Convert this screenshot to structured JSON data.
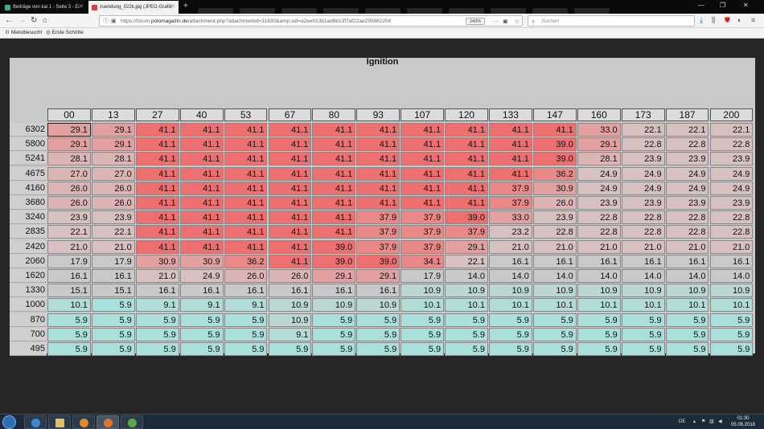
{
  "browser": {
    "tabs": [
      {
        "label": "Beiträge von kai 1 - Seite 3 - Ei"
      },
      {
        "label": "zuendung_022k.jpg (JPEG-Grafik"
      }
    ],
    "url_prefix": "https://forum.",
    "url_domain": "polomagazin.de",
    "url_path": "/attachment.php?attachmentid=31630&amp;sid=a2ee013b1ad6b13f7af22ae290862204",
    "zoom": "240%",
    "search_placeholder": "Suchen",
    "bookmarks": [
      "Meistbesucht",
      "Erste Schritte"
    ]
  },
  "table": {
    "title": "Ignition",
    "columns": [
      "00",
      "13",
      "27",
      "40",
      "53",
      "67",
      "80",
      "93",
      "107",
      "120",
      "133",
      "147",
      "160",
      "173",
      "187",
      "200"
    ],
    "rows": [
      {
        "rpm": "6302",
        "values": [
          "29.1",
          "29.1",
          "41.1",
          "41.1",
          "41.1",
          "41.1",
          "41.1",
          "41.1",
          "41.1",
          "41.1",
          "41.1",
          "41.1",
          "33.0",
          "22.1",
          "22.1",
          "22.1"
        ]
      },
      {
        "rpm": "5800",
        "values": [
          "29.1",
          "29.1",
          "41.1",
          "41.1",
          "41.1",
          "41.1",
          "41.1",
          "41.1",
          "41.1",
          "41.1",
          "41.1",
          "39.0",
          "29.1",
          "22.8",
          "22.8",
          "22.8"
        ]
      },
      {
        "rpm": "5241",
        "values": [
          "28.1",
          "28.1",
          "41.1",
          "41.1",
          "41.1",
          "41.1",
          "41.1",
          "41.1",
          "41.1",
          "41.1",
          "41.1",
          "39.0",
          "28.1",
          "23.9",
          "23.9",
          "23.9"
        ]
      },
      {
        "rpm": "4675",
        "values": [
          "27.0",
          "27.0",
          "41.1",
          "41.1",
          "41.1",
          "41.1",
          "41.1",
          "41.1",
          "41.1",
          "41.1",
          "41.1",
          "36.2",
          "24.9",
          "24.9",
          "24.9",
          "24.9"
        ]
      },
      {
        "rpm": "4160",
        "values": [
          "26.0",
          "26.0",
          "41.1",
          "41.1",
          "41.1",
          "41.1",
          "41.1",
          "41.1",
          "41.1",
          "41.1",
          "37.9",
          "30.9",
          "24.9",
          "24.9",
          "24.9",
          "24.9"
        ]
      },
      {
        "rpm": "3680",
        "values": [
          "26.0",
          "26.0",
          "41.1",
          "41.1",
          "41.1",
          "41.1",
          "41.1",
          "41.1",
          "41.1",
          "41.1",
          "37.9",
          "26.0",
          "23.9",
          "23.9",
          "23.9",
          "23.9"
        ]
      },
      {
        "rpm": "3240",
        "values": [
          "23.9",
          "23.9",
          "41.1",
          "41.1",
          "41.1",
          "41.1",
          "41.1",
          "37.9",
          "37.9",
          "39.0",
          "33.0",
          "23.9",
          "22.8",
          "22.8",
          "22.8",
          "22.8"
        ]
      },
      {
        "rpm": "2835",
        "values": [
          "22.1",
          "22.1",
          "41.1",
          "41.1",
          "41.1",
          "41.1",
          "41.1",
          "37.9",
          "37.9",
          "37.9",
          "23.2",
          "22.8",
          "22.8",
          "22.8",
          "22.8",
          "22.8"
        ]
      },
      {
        "rpm": "2420",
        "values": [
          "21.0",
          "21.0",
          "41.1",
          "41.1",
          "41.1",
          "41.1",
          "39.0",
          "37.9",
          "37.9",
          "29.1",
          "21.0",
          "21.0",
          "21.0",
          "21.0",
          "21.0",
          "21.0"
        ]
      },
      {
        "rpm": "2060",
        "values": [
          "17.9",
          "17.9",
          "30.9",
          "30.9",
          "36.2",
          "41.1",
          "39.0",
          "39.0",
          "34.1",
          "22.1",
          "16.1",
          "16.1",
          "16.1",
          "16.1",
          "16.1",
          "16.1"
        ]
      },
      {
        "rpm": "1620",
        "values": [
          "16.1",
          "16.1",
          "21.0",
          "24.9",
          "26.0",
          "26.0",
          "29.1",
          "29.1",
          "17.9",
          "14.0",
          "14.0",
          "14.0",
          "14.0",
          "14.0",
          "14.0",
          "14.0"
        ]
      },
      {
        "rpm": "1330",
        "values": [
          "15.1",
          "15.1",
          "16.1",
          "16.1",
          "16.1",
          "16.1",
          "16.1",
          "16.1",
          "10.9",
          "10.9",
          "10.9",
          "10.9",
          "10.9",
          "10.9",
          "10.9",
          "10.9"
        ]
      },
      {
        "rpm": "1000",
        "values": [
          "10.1",
          "5.9",
          "9.1",
          "9.1",
          "9.1",
          "10.9",
          "10.9",
          "10.9",
          "10.1",
          "10.1",
          "10.1",
          "10.1",
          "10.1",
          "10.1",
          "10.1",
          "10.1"
        ]
      },
      {
        "rpm": "870",
        "values": [
          "5.9",
          "5.9",
          "5.9",
          "5.9",
          "5.9",
          "10.9",
          "5.9",
          "5.9",
          "5.9",
          "5.9",
          "5.9",
          "5.9",
          "5.9",
          "5.9",
          "5.9",
          "5.9"
        ]
      },
      {
        "rpm": "700",
        "values": [
          "5.9",
          "5.9",
          "5.9",
          "5.9",
          "5.9",
          "9.1",
          "5.9",
          "5.9",
          "5.9",
          "5.9",
          "5.9",
          "5.9",
          "5.9",
          "5.9",
          "5.9",
          "5.9"
        ]
      },
      {
        "rpm": "495",
        "values": [
          "5.9",
          "5.9",
          "5.9",
          "5.9",
          "5.9",
          "5.9",
          "5.9",
          "5.9",
          "5.9",
          "5.9",
          "5.9",
          "5.9",
          "5.9",
          "5.9",
          "5.9",
          "5.9"
        ]
      }
    ]
  },
  "colors": {
    "high": "#ee6f6f",
    "mid": "#c9c9c9",
    "low": "#a9e0dc"
  },
  "taskbar": {
    "language": "DE",
    "time": "01:30",
    "date": "05.06.2018"
  }
}
